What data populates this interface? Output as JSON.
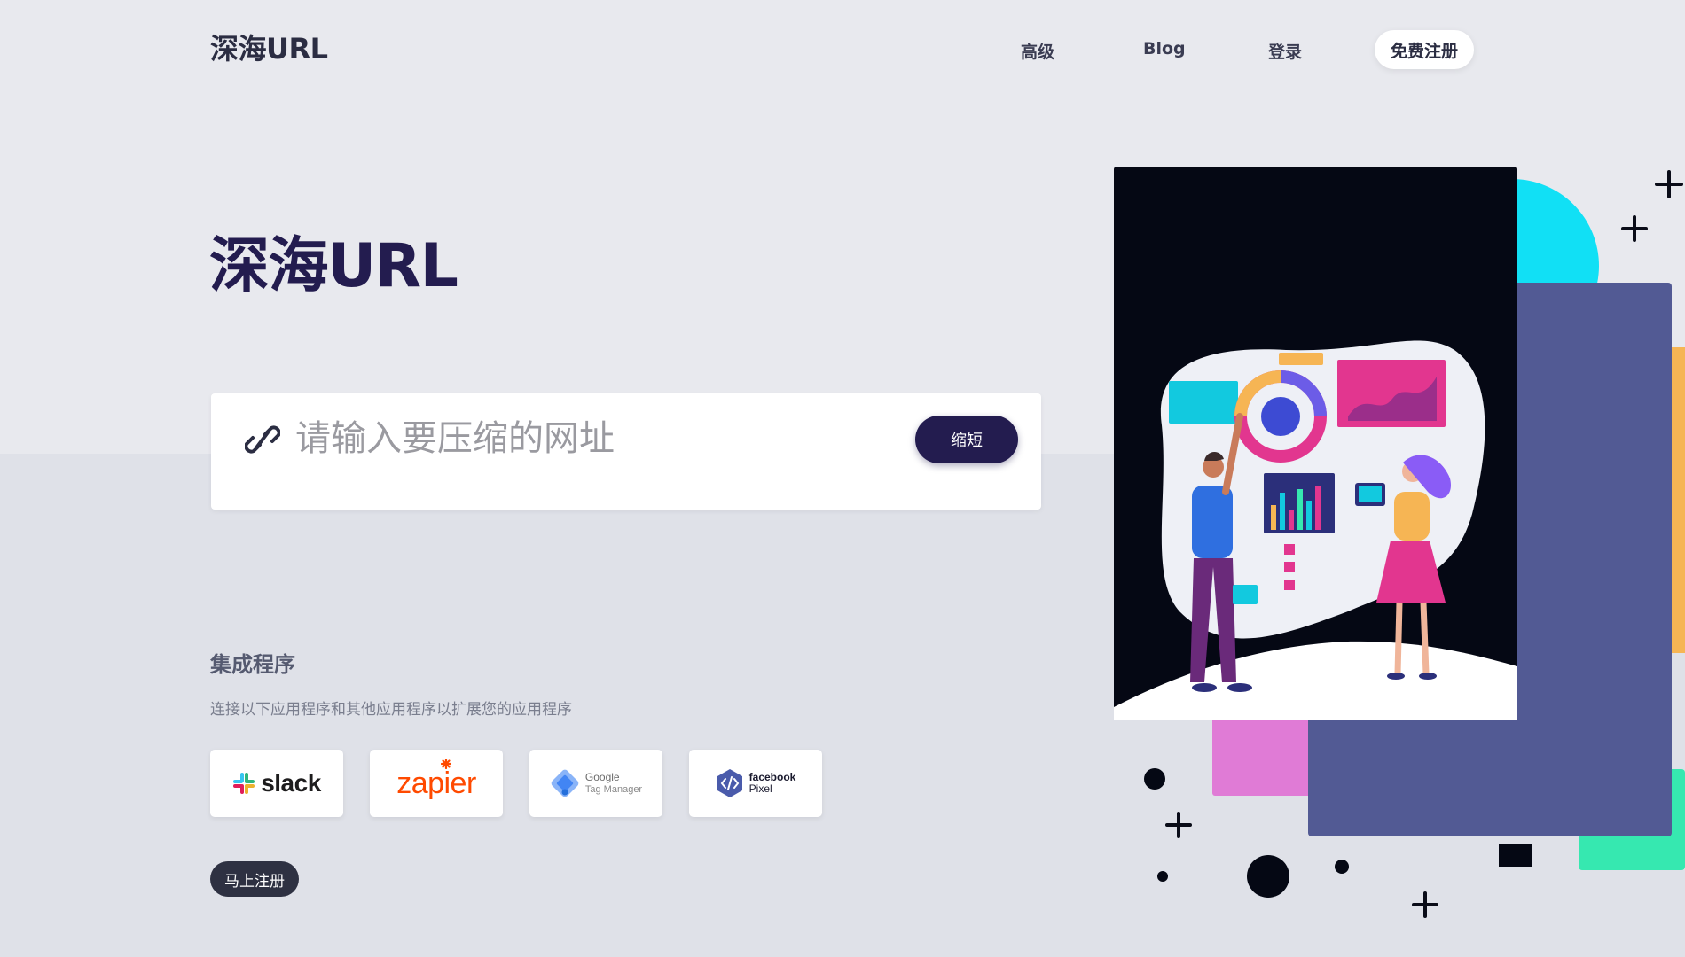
{
  "header": {
    "logo": "深海URL",
    "nav": [
      "高级",
      "Blog",
      "登录"
    ],
    "signup": "免费注册"
  },
  "hero": {
    "title": "深海URL",
    "input_placeholder": "请输入要压缩的网址",
    "shorten_label": "缩短"
  },
  "integrations": {
    "title": "集成程序",
    "subtitle": "连接以下应用程序和其他应用程序以扩展您的应用程序",
    "apps": [
      {
        "name": "slack",
        "icon": "slack-icon"
      },
      {
        "name": "zapier",
        "icon": "zapier-icon"
      },
      {
        "line1": "Google",
        "line2": "Tag Manager",
        "icon": "google-tag-manager-icon"
      },
      {
        "line1": "facebook",
        "line2": "Pixel",
        "icon": "facebook-pixel-icon"
      }
    ],
    "cta": "马上注册"
  },
  "colors": {
    "brand_dark": "#231c4f",
    "panel_purple": "#525a94",
    "cyan": "#11e0f5",
    "pink": "#e07bd6",
    "green": "#36e8b0"
  }
}
